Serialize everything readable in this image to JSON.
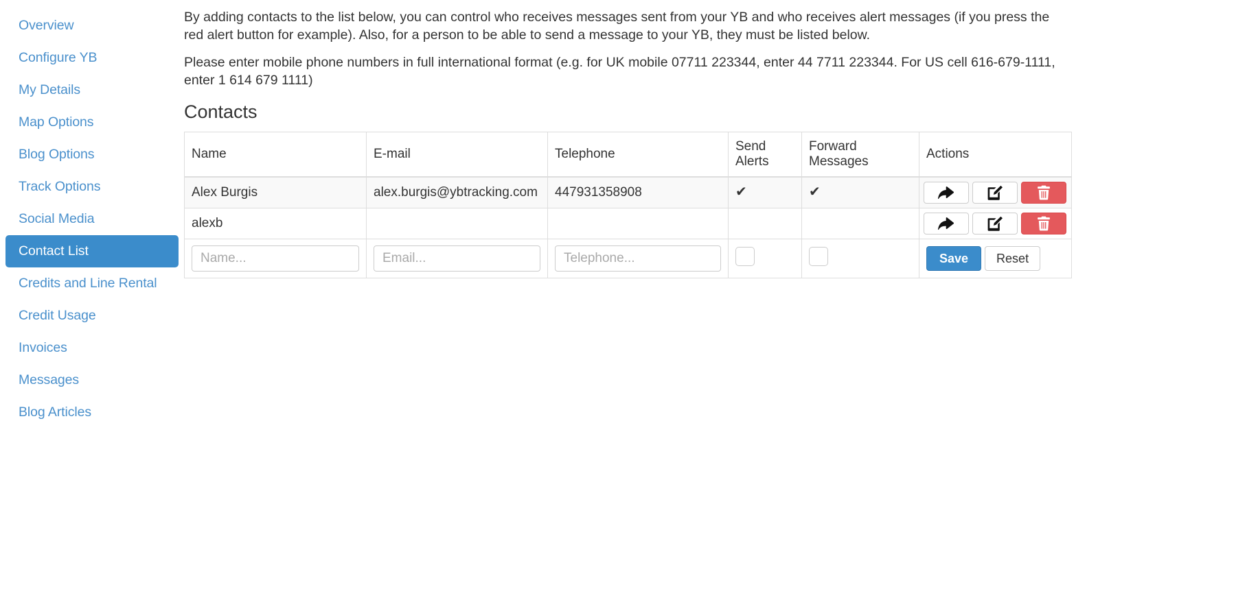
{
  "sidebar": {
    "items": [
      {
        "label": "Overview",
        "active": false
      },
      {
        "label": "Configure YB",
        "active": false
      },
      {
        "label": "My Details",
        "active": false
      },
      {
        "label": "Map Options",
        "active": false
      },
      {
        "label": "Blog Options",
        "active": false
      },
      {
        "label": "Track Options",
        "active": false
      },
      {
        "label": "Social Media",
        "active": false
      },
      {
        "label": "Contact List",
        "active": true
      },
      {
        "label": "Credits and Line Rental",
        "active": false
      },
      {
        "label": "Credit Usage",
        "active": false
      },
      {
        "label": "Invoices",
        "active": false
      },
      {
        "label": "Messages",
        "active": false
      },
      {
        "label": "Blog Articles",
        "active": false
      }
    ],
    "active_color": "#3b8ccb",
    "link_color": "#4a90cc"
  },
  "main": {
    "intro_paragraph": "By adding contacts to the list below, you can control who receives messages sent from your YB and who receives alert messages (if you press the red alert button for example). Also, for a person to be able to send a message to your YB, they must be listed below.",
    "format_paragraph": "Please enter mobile phone numbers in full international format (e.g. for UK mobile 07711 223344, enter 44 7711 223344. For US cell 616-679-1111, enter 1 614 679 1111)",
    "section_title": "Contacts",
    "table": {
      "headers": [
        "Name",
        "E-mail",
        "Telephone",
        "Send Alerts",
        "Forward Messages",
        "Actions"
      ],
      "rows": [
        {
          "name": "Alex Burgis",
          "email": "alex.burgis@ybtracking.com",
          "telephone": "447931358908",
          "send_alerts": "✔",
          "forward_messages": "✔"
        },
        {
          "name": "alexb",
          "email": "",
          "telephone": "",
          "send_alerts": "",
          "forward_messages": ""
        }
      ],
      "row_actions": {
        "forward_title": "Forward",
        "edit_title": "Edit",
        "delete_title": "Delete"
      },
      "form_row": {
        "name_placeholder": "Name...",
        "name_value": "",
        "email_placeholder": "Email...",
        "email_value": "",
        "telephone_placeholder": "Telephone...",
        "telephone_value": "",
        "send_alerts_checked": false,
        "forward_messages_checked": false,
        "save_label": "Save",
        "reset_label": "Reset"
      }
    }
  },
  "colors": {
    "primary": "#3b8ccb",
    "danger": "#e4595c",
    "link": "#4a90cc",
    "text": "#333333",
    "border": "#dddddd"
  }
}
